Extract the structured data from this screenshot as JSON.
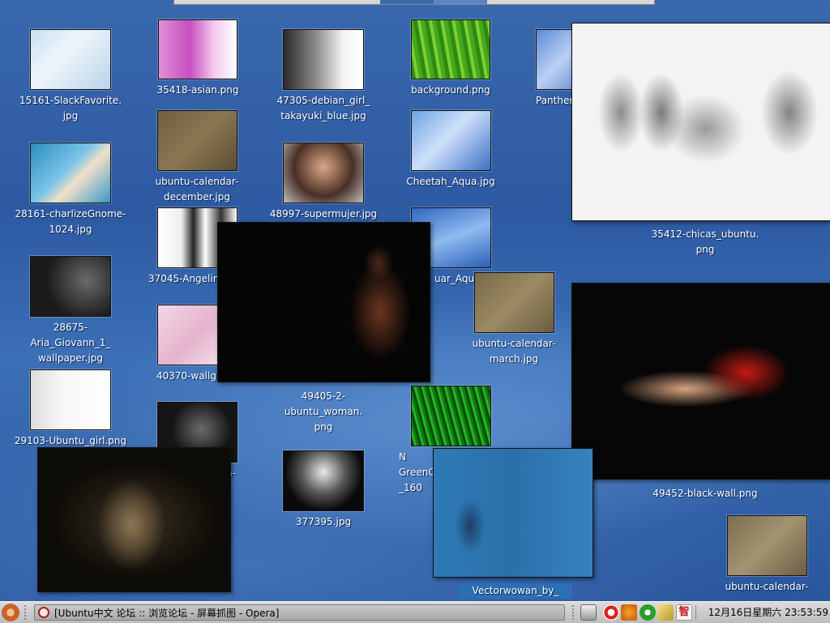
{
  "desktop_icons": [
    {
      "label": "15161-SlackFavorite.\njpg"
    },
    {
      "label": "28161-charlizeGnome-\n1024.jpg"
    },
    {
      "label": "28675-Aria_Giovann_1_\nwallpaper.jpg"
    },
    {
      "label": "29103-Ubuntu_girl.png"
    },
    {
      "label": "35418-asian.png"
    },
    {
      "label": "ubuntu-calendar-\ndecember.jpg"
    },
    {
      "label": "37045-Angelin"
    },
    {
      "label": "40370-wallgi"
    },
    {
      "label": "n-"
    },
    {
      "label": "47305-debian_girl_\ntakayuki_blue.jpg"
    },
    {
      "label": "48997-supermujer.jpg"
    },
    {
      "label": "49405-2-ubuntu_woman.\npng"
    },
    {
      "label": "377395.jpg"
    },
    {
      "label": "background.png"
    },
    {
      "label": "Cheetah_Aqua.jpg"
    },
    {
      "label": "uar_Aqua"
    },
    {
      "label": "N\nGreenG\n_160"
    },
    {
      "label": "ubuntu-calendar-\nmarch.jpg"
    },
    {
      "label": "Panther"
    },
    {
      "label": "35412-chicas_ubuntu.\npng"
    },
    {
      "label": "49452-black-wall.png"
    },
    {
      "label": "ubuntu-calendar-"
    },
    {
      "label": "Vectorwowan_by_"
    }
  ],
  "taskbar": {
    "ubuntu_menu_icon": "ubuntu-logo-icon",
    "window_title": "[Ubuntu中文 论坛 :: 浏览论坛 - 屏幕抓图 - Opera]",
    "window_icon": "opera-icon",
    "tray": [
      {
        "icon": "printer-icon"
      },
      {
        "icon": "lifebuoy-icon"
      },
      {
        "icon": "update-notifier-icon"
      },
      {
        "icon": "recycle-icon"
      },
      {
        "icon": "usb-key-icon"
      },
      {
        "icon": "input-method-icon",
        "text": "智"
      }
    ],
    "clock": "12月16日星期六 23:53:59"
  }
}
